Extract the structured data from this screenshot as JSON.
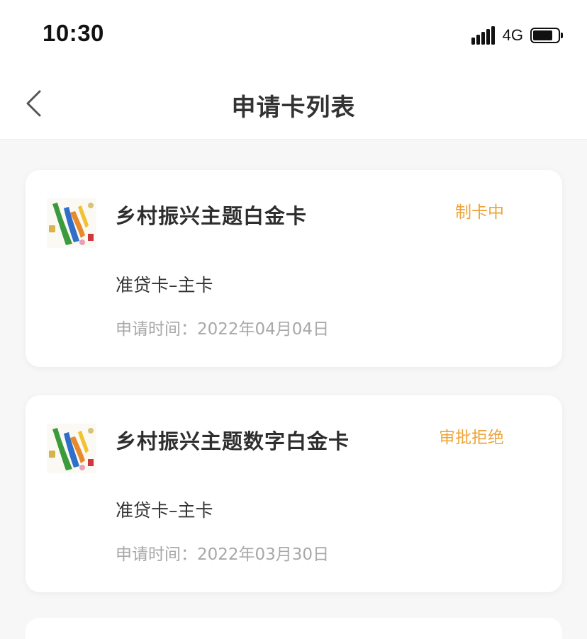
{
  "status_bar": {
    "time": "10:30",
    "network": "4G",
    "battery_level": 0.8
  },
  "nav": {
    "title": "申请卡列表",
    "back_icon": "chevron-left-icon"
  },
  "cards": [
    {
      "name": "乡村振兴主题白金卡",
      "status": "制卡中",
      "type": "准贷卡–主卡",
      "date": "申请时间：2022年04月04日"
    },
    {
      "name": "乡村振兴主题数字白金卡",
      "status": "审批拒绝",
      "type": "准贷卡–主卡",
      "date": "申请时间：2022年03月30日"
    }
  ],
  "colors": {
    "status_accent": "#eea43a",
    "page_background": "#f7f7f7"
  }
}
